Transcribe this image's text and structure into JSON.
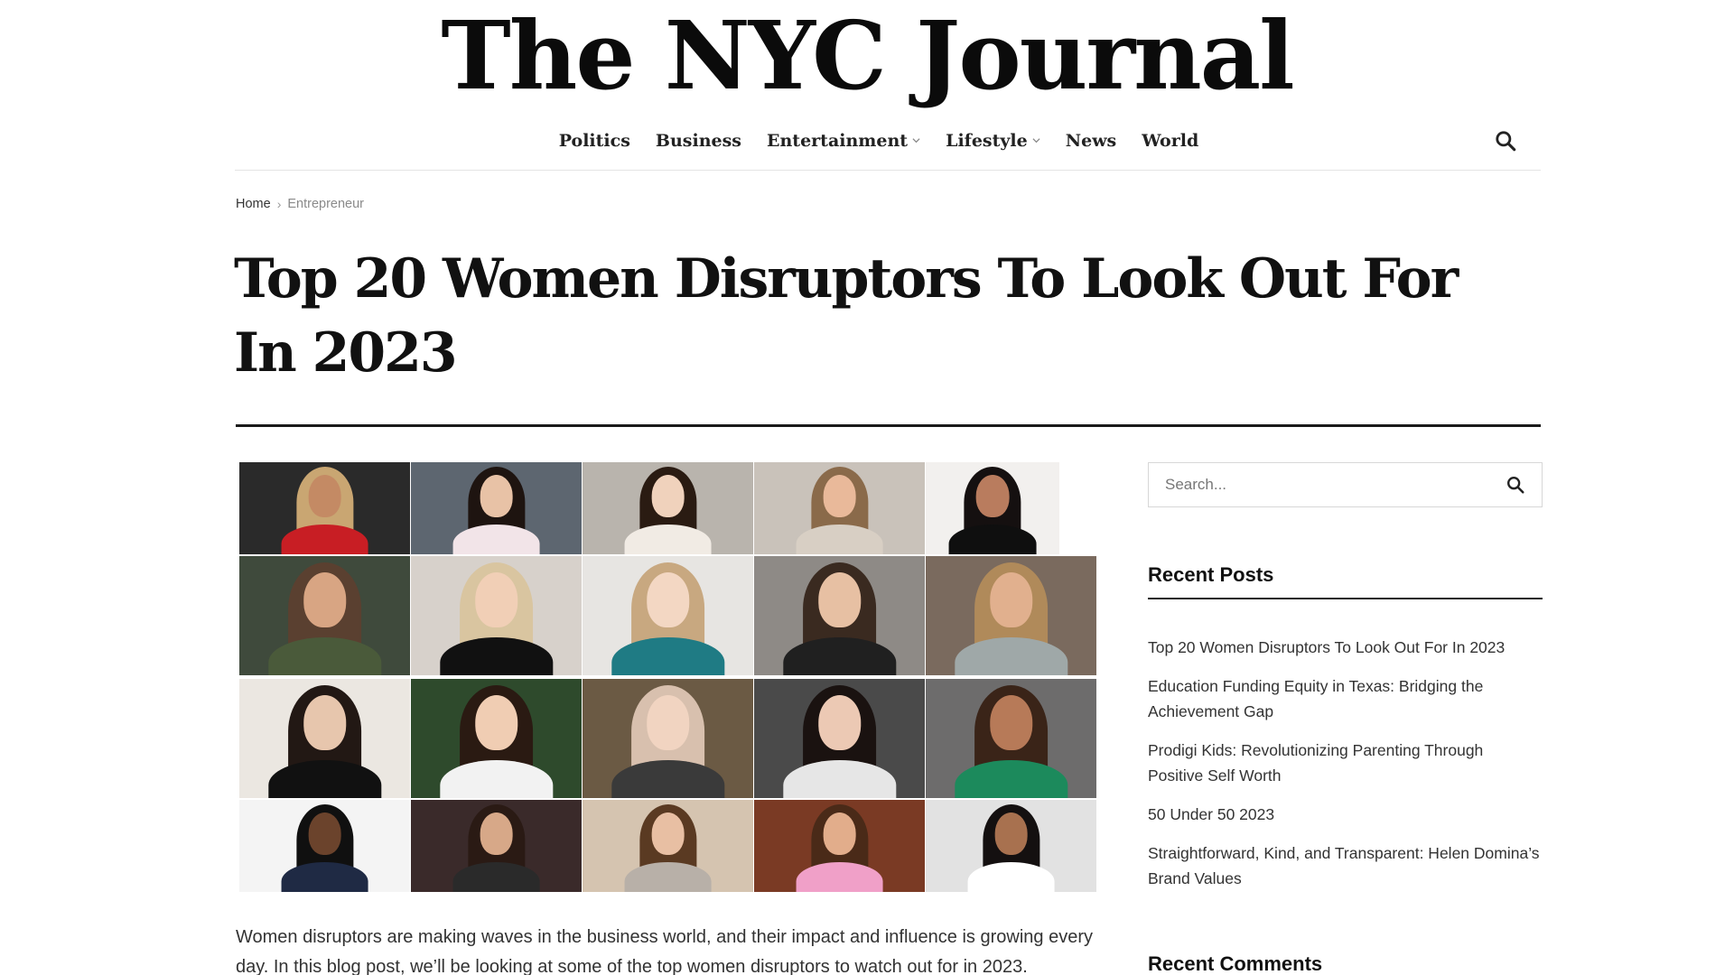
{
  "site": {
    "logo_text": "The NYC Journal"
  },
  "nav": {
    "items": [
      {
        "label": "Politics",
        "has_dropdown": false
      },
      {
        "label": "Business",
        "has_dropdown": false
      },
      {
        "label": "Entertainment",
        "has_dropdown": true
      },
      {
        "label": "Lifestyle",
        "has_dropdown": true
      },
      {
        "label": "News",
        "has_dropdown": false
      },
      {
        "label": "World",
        "has_dropdown": false
      }
    ],
    "search_icon": "search-icon"
  },
  "breadcrumb": {
    "home": "Home",
    "separator": "›",
    "current": "Entrepreneur"
  },
  "article": {
    "title": "Top 20 Women Disruptors To Look Out For In 2023",
    "intro": "Women disruptors are making waves in the business world, and their impact and influence is growing every day. In this blog post, we’ll be looking at some of the top women disruptors to watch out for in 2023."
  },
  "sidebar": {
    "search": {
      "placeholder": "Search..."
    },
    "recent_posts": {
      "heading": "Recent Posts",
      "items": [
        "Top 20 Women Disruptors To Look Out For In 2023",
        "Education Funding Equity in Texas: Bridging the Achievement Gap",
        "Prodigi Kids: Revolutionizing Parenting Through Positive Self Worth",
        "50 Under 50 2023",
        "Straightforward, Kind, and Transparent: Helen Domina’s Brand Values"
      ]
    },
    "recent_comments": {
      "heading": "Recent Comments"
    }
  },
  "colors": {
    "text": "#111111",
    "rule": "#1a1a1a",
    "muted": "#8a8a8a",
    "border": "#d7d7d7"
  }
}
